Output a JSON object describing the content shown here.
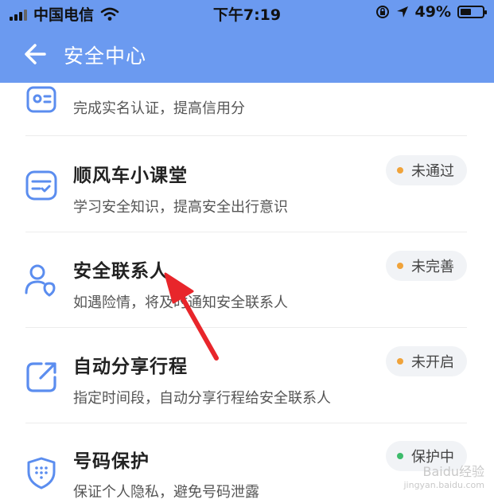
{
  "status_bar": {
    "carrier": "中国电信",
    "time": "下午7:19",
    "battery_percent": "49%",
    "battery_level": 0.49
  },
  "nav": {
    "title": "安全中心"
  },
  "items": [
    {
      "desc": "完成实名认证，提高信用分"
    },
    {
      "title": "顺风车小课堂",
      "desc": "学习安全知识，提高安全出行意识",
      "status": "未通过",
      "status_color": "#f0a33a"
    },
    {
      "title": "安全联系人",
      "desc": "如遇险情，将及时通知安全联系人",
      "status": "未完善",
      "status_color": "#f0a33a"
    },
    {
      "title": "自动分享行程",
      "desc": "指定时间段，自动分享行程给安全联系人",
      "status": "未开启",
      "status_color": "#f0a33a"
    },
    {
      "title": "号码保护",
      "desc": "保证个人隐私，避免号码泄露",
      "status": "保护中",
      "status_color": "#3dbb6b"
    }
  ],
  "colors": {
    "accent": "#6b9af0",
    "icon": "#5b8def"
  },
  "watermark": {
    "brand": "Baidu经验",
    "url": "jingyan.baidu.com"
  }
}
